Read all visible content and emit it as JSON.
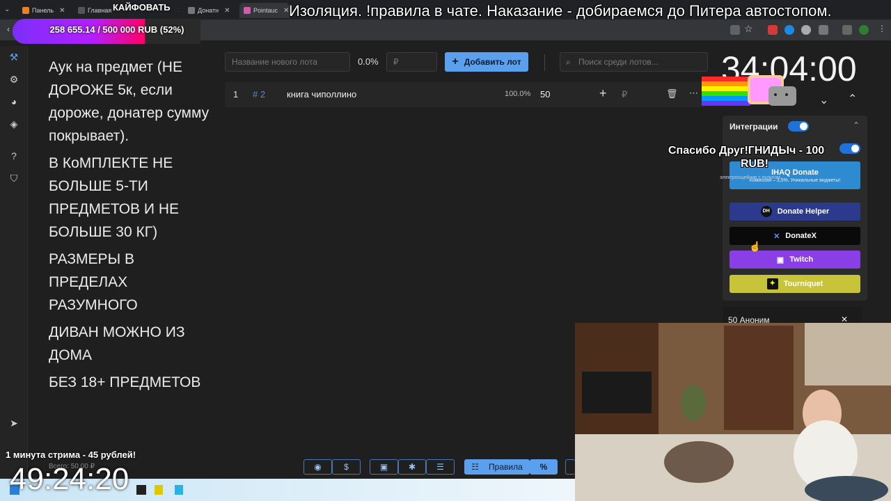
{
  "browser": {
    "tabs": [
      {
        "label": "Панель"
      },
      {
        "label": "Главная"
      },
      {
        "label": "Донатн"
      },
      {
        "label": "Pointauc"
      }
    ]
  },
  "overlays": {
    "kaifovat": "КАЙФОВАТЬ",
    "goal_text": "258 655.14 / 500 000 RUB (52%)",
    "goal_progress": 0.52,
    "marquee": "Изоляция. !правила в чате. Наказание - добираемся до Питера автостопом.",
    "thanks_line1": "Спасибо Друг!ГНИДЫч - 100",
    "thanks_line2": "RUB!",
    "stream_minute": "1 минута стрима - 45 рублей!",
    "clock": "49:24:20",
    "total_label": "Всего: 50.00 ₽",
    "donation_widget": "50 Аноним"
  },
  "rules": [
    "Аук на предмет (НЕ ДОРОЖЕ 5к, если дороже, донатер сумму покрывает).",
    "В КоМПЛЕКТЕ НЕ БОЛЬШЕ 5-ТИ ПРЕДМЕТОВ И НЕ БОЛЬШЕ 30 КГ)",
    "РАЗМЕРЫ В ПРЕДЕЛАХ РАЗУМНОГО",
    "ДИВАН МОЖНО ИЗ ДОМА",
    "БЕЗ 18+ ПРЕДМЕТОВ"
  ],
  "toolbar": {
    "lot_name_placeholder": "Название нового лота",
    "percent": "0.0%",
    "amount_placeholder": "₽",
    "add_lot_label": "Добавить лот",
    "search_placeholder": "Поиск среди лотов..."
  },
  "lots": [
    {
      "index": "1",
      "tag": "# 2",
      "name": "книга чиполлино",
      "percent": "100.0%",
      "amount": "50",
      "currency": "₽"
    }
  ],
  "timer": "34:04:00",
  "integrations": {
    "title": "Интеграции",
    "ihaq_label": "IHAQ Donate",
    "ihaq_sub": "Комиссия – 3,5%. Уникальные виджеты!",
    "ihaq_sub2": "электросщейник с пультом",
    "buttons": [
      {
        "label": "Donate Helper",
        "color": "#2b3a8c"
      },
      {
        "label": "DonateX",
        "color": "#0a0a0a"
      },
      {
        "label": "Twitch",
        "color": "#8a3ee6"
      },
      {
        "label": "Tourniquet",
        "color": "#c8c43a"
      }
    ]
  },
  "bottom": {
    "rules_button": "Правила",
    "percent_button": "%"
  }
}
